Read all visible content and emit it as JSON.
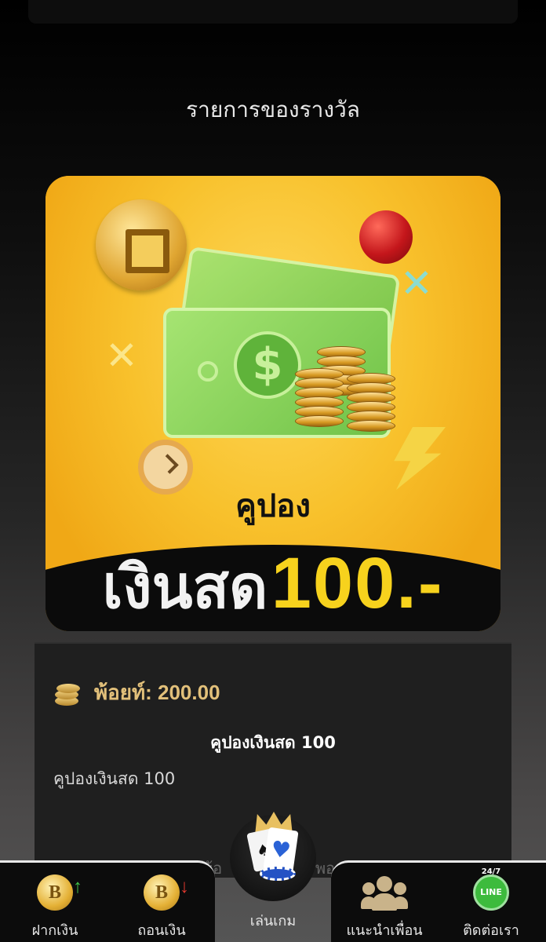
{
  "page": {
    "title": "รายการของรางวัล"
  },
  "prize_banner": {
    "coupon_word": "คูปอง",
    "cash_word": "เงินสด",
    "cash_amount": "100.-",
    "accent_color": "#f7d21d"
  },
  "reward_detail": {
    "points_label": "พ้อยท์: 200.00",
    "item_title": "คูปองเงินสด 100",
    "item_description": "คูปองเงินสด 100",
    "faded_left": "พ้อ",
    "faded_right": "พอ"
  },
  "bottom_nav": {
    "items": [
      {
        "label": "ฝากเงิน",
        "icon": "deposit-coin-icon"
      },
      {
        "label": "ถอนเงิน",
        "icon": "withdraw-coin-icon"
      },
      {
        "label": "เล่นเกม",
        "icon": "play-game-icon"
      },
      {
        "label": "แนะนำเพื่อน",
        "icon": "friends-icon"
      },
      {
        "label": "ติดต่อเรา",
        "icon": "line-chat-icon",
        "badge": "24/7",
        "icon_text": "LINE"
      }
    ],
    "coin_letter": "B"
  }
}
